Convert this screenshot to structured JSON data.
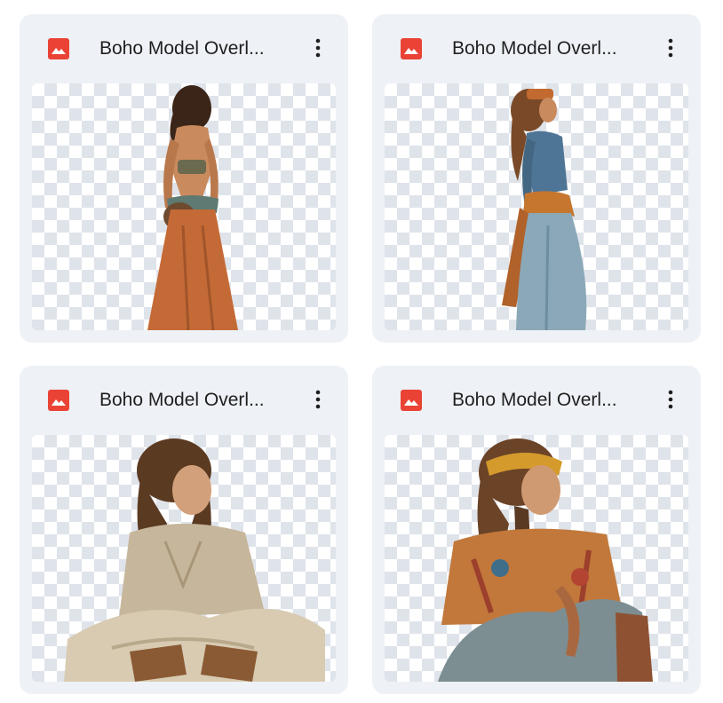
{
  "files": [
    {
      "name": "Boho Model Overl...",
      "icon": "image-file-icon",
      "menu_icon": "more-vert-icon"
    },
    {
      "name": "Boho Model Overl...",
      "icon": "image-file-icon",
      "menu_icon": "more-vert-icon"
    },
    {
      "name": "Boho Model Overl...",
      "icon": "image-file-icon",
      "menu_icon": "more-vert-icon"
    },
    {
      "name": "Boho Model Overl...",
      "icon": "image-file-icon",
      "menu_icon": "more-vert-icon"
    }
  ],
  "colors": {
    "card_bg": "#eef1f6",
    "file_icon_red": "#ea4335",
    "checker_dark": "#dfe3ea",
    "title_text": "#1f1f1f"
  }
}
